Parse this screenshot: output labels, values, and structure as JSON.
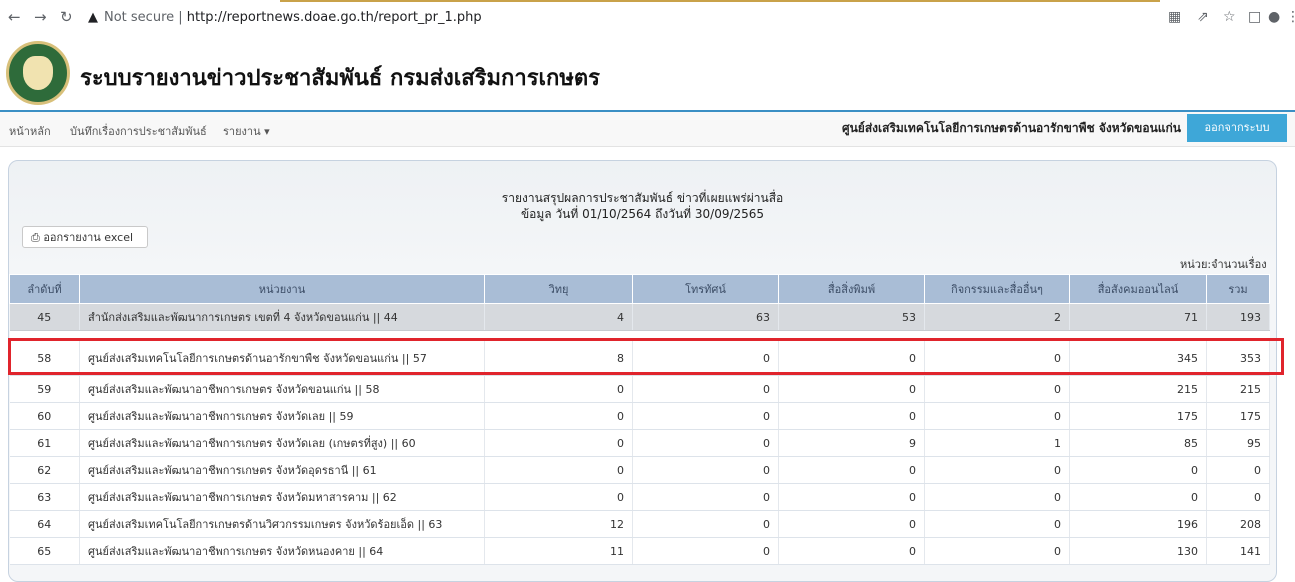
{
  "browser": {
    "security_label": "Not secure",
    "url": "http://reportnews.doae.go.th/report_pr_1.php"
  },
  "site": {
    "title": "ระบบรายงานข่าวประชาสัมพันธ์ กรมส่งเสริมการเกษตร"
  },
  "navbar": {
    "items": [
      "หน้าหลัก",
      "บันทึกเรื่องการประชาสัมพันธ์",
      "รายงาน"
    ],
    "org_name": "ศูนย์ส่งเสริมเทคโนโลยีการเกษตรด้านอารักขาพืช จังหวัดขอนแก่น",
    "logout_label": "ออกจากระบบ"
  },
  "report": {
    "title": "รายงานสรุปผลการประชาสัมพันธ์ ข่าวที่เผยแพร่ผ่านสื่อ",
    "subtitle": "ข้อมูล วันที่ 01/10/2564  ถึงวันที่ 30/09/2565",
    "excel_label": "ออกรายงาน excel",
    "unit_label": "หน่วย:จำนวนเรื่อง"
  },
  "table": {
    "headers": [
      "ลำดับที่",
      "หน่วยงาน",
      "วิทยุ",
      "โทรทัศน์",
      "สื่อสิ่งพิมพ์",
      "กิจกรรมและสื่ออื่นๆ",
      "สื่อสังคมออนไลน์",
      "รวม"
    ],
    "rows": [
      [
        "45",
        "สำนักส่งเสริมและพัฒนาการเกษตร เขตที่ 4 จังหวัดขอนแก่น || 44",
        "4",
        "63",
        "53",
        "2",
        "71",
        "193"
      ],
      [
        "58",
        "ศูนย์ส่งเสริมเทคโนโลยีการเกษตรด้านอารักขาพืช จังหวัดขอนแก่น || 57",
        "8",
        "0",
        "0",
        "0",
        "345",
        "353"
      ],
      [
        "59",
        "ศูนย์ส่งเสริมและพัฒนาอาชีพการเกษตร จังหวัดขอนแก่น || 58",
        "0",
        "0",
        "0",
        "0",
        "215",
        "215"
      ],
      [
        "60",
        "ศูนย์ส่งเสริมและพัฒนาอาชีพการเกษตร จังหวัดเลย || 59",
        "0",
        "0",
        "0",
        "0",
        "175",
        "175"
      ],
      [
        "61",
        "ศูนย์ส่งเสริมและพัฒนาอาชีพการเกษตร จังหวัดเลย (เกษตรที่สูง) || 60",
        "0",
        "0",
        "9",
        "1",
        "85",
        "95"
      ],
      [
        "62",
        "ศูนย์ส่งเสริมและพัฒนาอาชีพการเกษตร จังหวัดอุดรธานี || 61",
        "0",
        "0",
        "0",
        "0",
        "0",
        "0"
      ],
      [
        "63",
        "ศูนย์ส่งเสริมและพัฒนาอาชีพการเกษตร จังหวัดมหาสารคาม || 62",
        "0",
        "0",
        "0",
        "0",
        "0",
        "0"
      ],
      [
        "64",
        "ศูนย์ส่งเสริมเทคโนโลยีการเกษตรด้านวิศวกรรมเกษตร จังหวัดร้อยเอ็ด || 63",
        "12",
        "0",
        "0",
        "0",
        "196",
        "208"
      ],
      [
        "65",
        "ศูนย์ส่งเสริมและพัฒนาอาชีพการเกษตร จังหวัดหนองคาย || 64",
        "11",
        "0",
        "0",
        "0",
        "130",
        "141"
      ]
    ]
  }
}
